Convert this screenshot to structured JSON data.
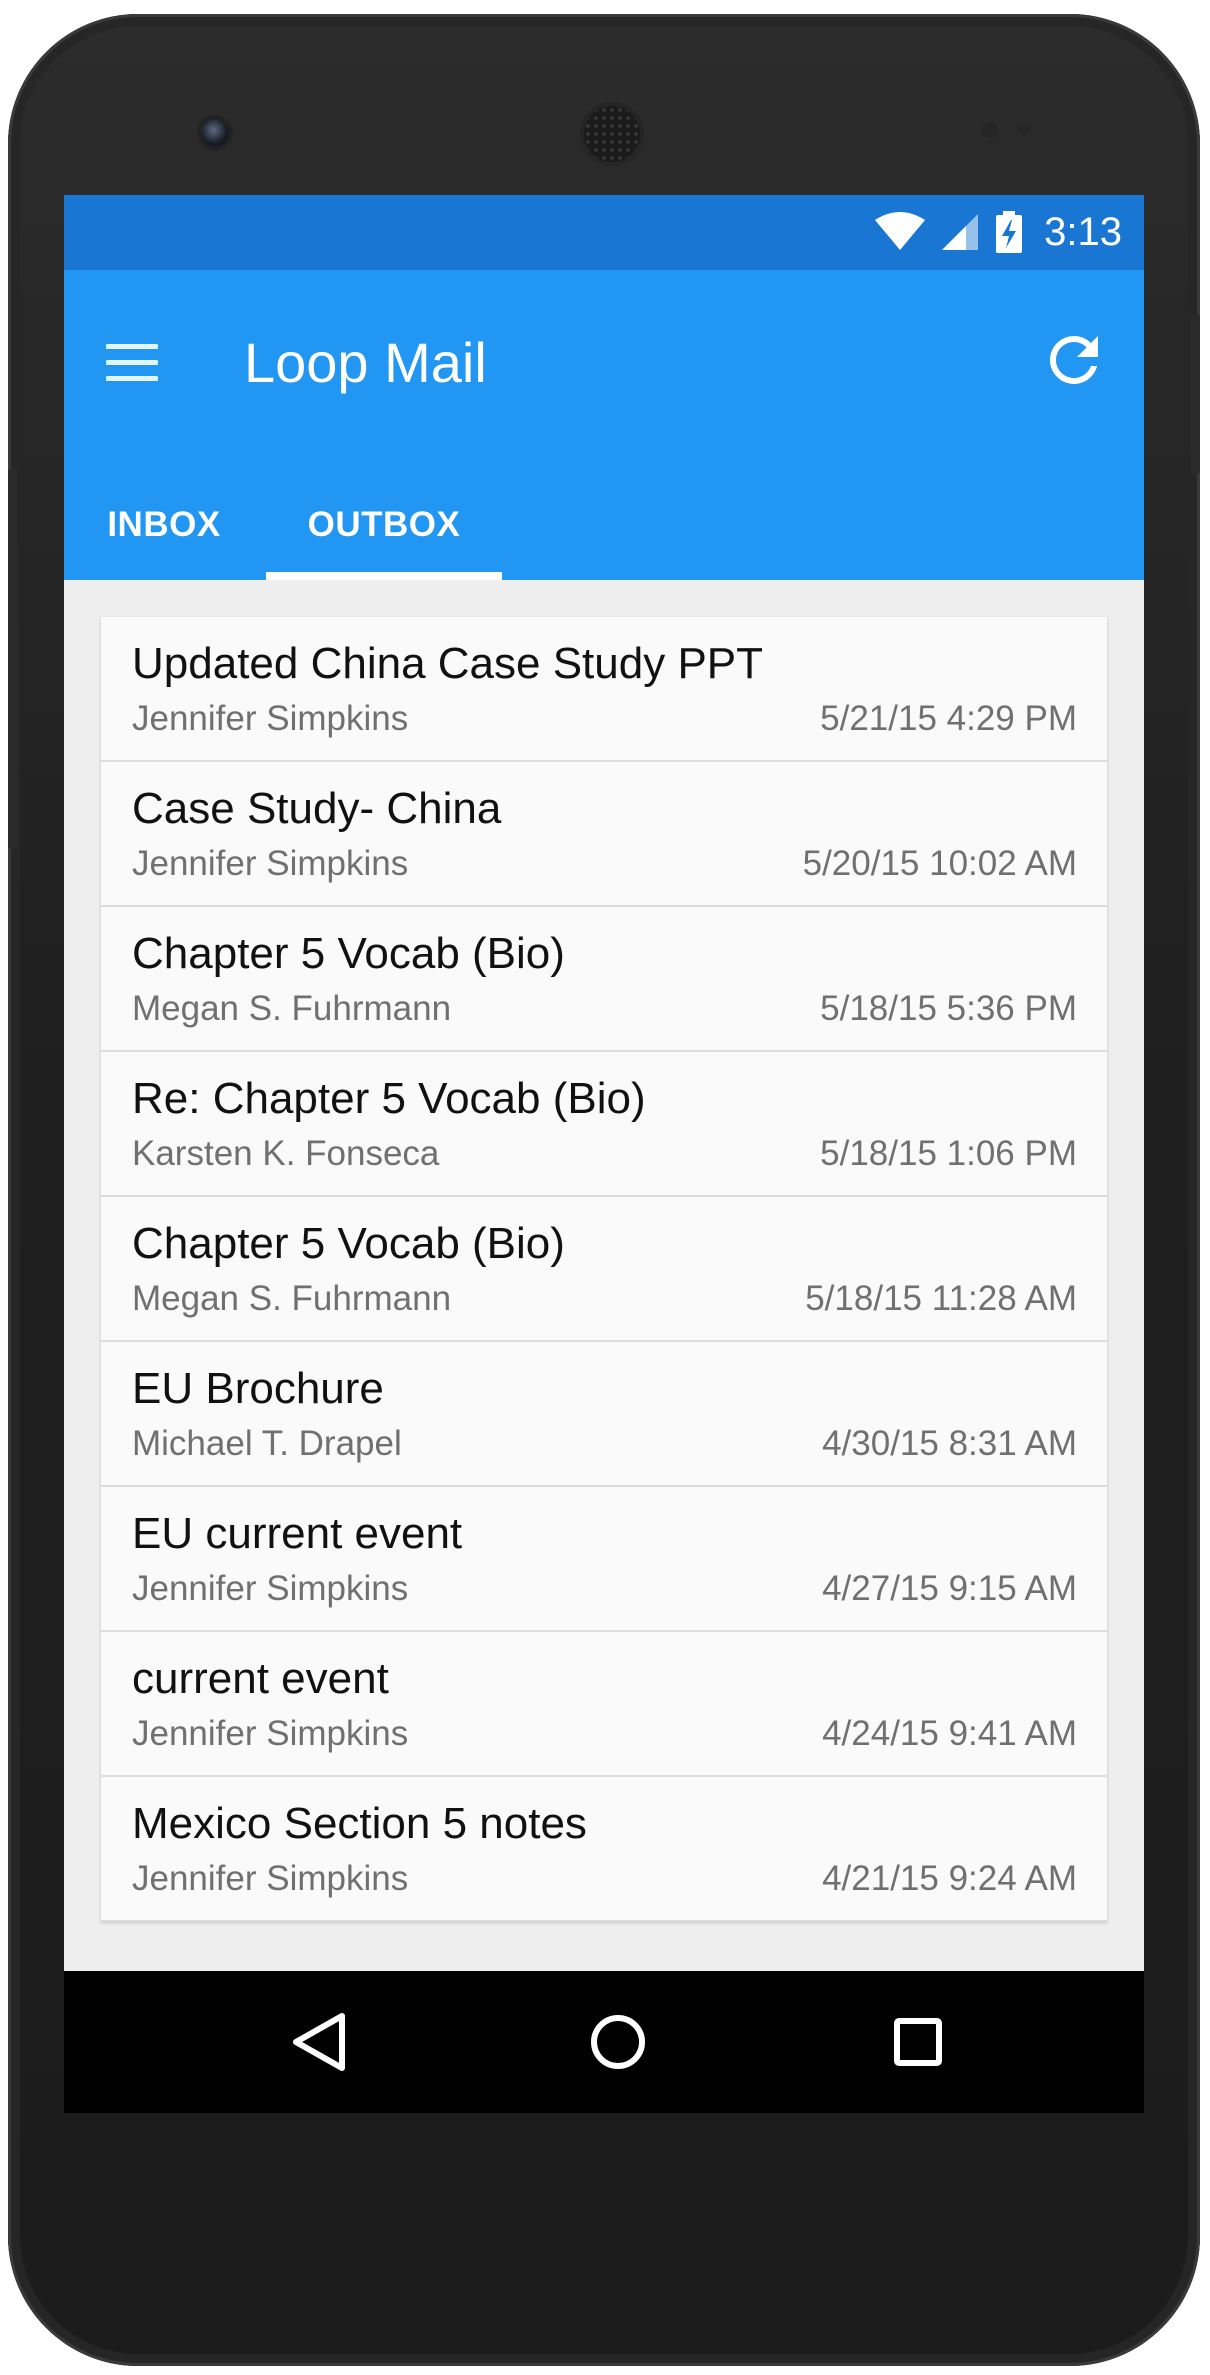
{
  "status_bar": {
    "time": "3:13",
    "icons": [
      "wifi-icon",
      "signal-icon",
      "battery-charging-icon"
    ]
  },
  "app_bar": {
    "title": "Loop Mail",
    "menu_icon": "menu-icon",
    "refresh_icon": "refresh-icon"
  },
  "tabs": [
    {
      "label": "INBOX",
      "selected": false
    },
    {
      "label": "OUTBOX",
      "selected": true
    }
  ],
  "messages": [
    {
      "subject": "Updated China Case Study PPT",
      "sender": "Jennifer Simpkins",
      "date": "5/21/15 4:29 PM"
    },
    {
      "subject": "Case Study- China",
      "sender": "Jennifer Simpkins",
      "date": "5/20/15 10:02 AM"
    },
    {
      "subject": "Chapter 5 Vocab (Bio)",
      "sender": "Megan S. Fuhrmann",
      "date": "5/18/15 5:36 PM"
    },
    {
      "subject": "Re: Chapter 5 Vocab (Bio)",
      "sender": "Karsten K. Fonseca",
      "date": "5/18/15 1:06 PM"
    },
    {
      "subject": "Chapter 5 Vocab (Bio)",
      "sender": "Megan S. Fuhrmann",
      "date": "5/18/15 11:28 AM"
    },
    {
      "subject": "EU Brochure",
      "sender": "Michael T. Drapel",
      "date": "4/30/15 8:31 AM"
    },
    {
      "subject": "EU current event",
      "sender": "Jennifer Simpkins",
      "date": "4/27/15 9:15 AM"
    },
    {
      "subject": "current event",
      "sender": "Jennifer Simpkins",
      "date": "4/24/15 9:41 AM"
    },
    {
      "subject": "Mexico Section 5 notes",
      "sender": "Jennifer Simpkins",
      "date": "4/21/15 9:24 AM"
    }
  ],
  "nav_bar": {
    "icons": [
      "back-icon",
      "home-icon",
      "recent-apps-icon"
    ]
  },
  "colors": {
    "status_bar": "#1976d2",
    "app_bar": "#2196f3",
    "list_background": "#fafafa",
    "screen_background": "#eeeeee",
    "nav_bar": "#000000"
  }
}
